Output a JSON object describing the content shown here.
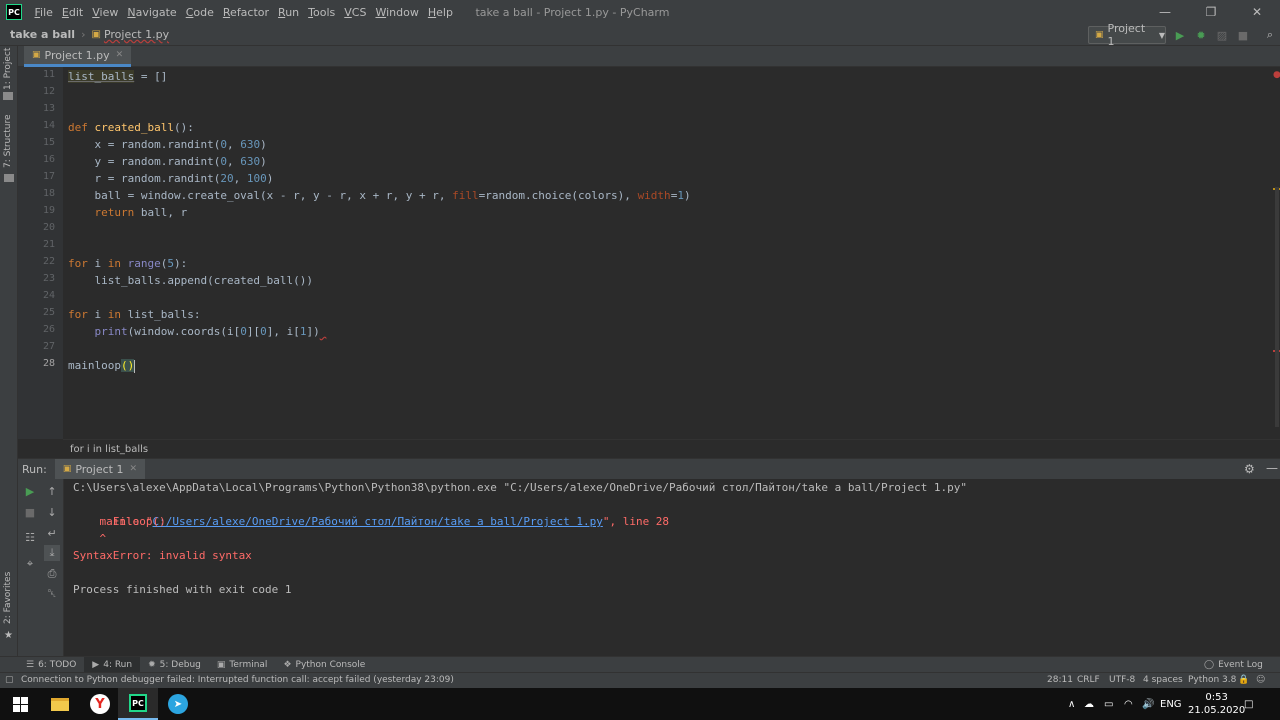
{
  "menubar": {
    "logo": "PC",
    "items": [
      "File",
      "Edit",
      "View",
      "Navigate",
      "Code",
      "Refactor",
      "Run",
      "Tools",
      "VCS",
      "Window",
      "Help"
    ],
    "window_title": "take a ball - Project 1.py - PyCharm"
  },
  "navbar": {
    "project": "take a ball",
    "file": "Project 1.py",
    "run_config": "Project 1"
  },
  "left_strip": {
    "project_tab": "1: Project",
    "structure_tab": "7: Structure",
    "favorites_tab": "2: Favorites"
  },
  "editor": {
    "tab_label": "Project 1.py",
    "line_numbers": [
      "11",
      "12",
      "13",
      "14",
      "15",
      "16",
      "17",
      "18",
      "19",
      "20",
      "21",
      "22",
      "23",
      "24",
      "25",
      "26",
      "27",
      "28"
    ],
    "breadcrumb": "for i in list_balls"
  },
  "run_panel": {
    "label": "Run:",
    "tab": "Project 1",
    "console": {
      "cmd": "C:\\Users\\alexe\\AppData\\Local\\Programs\\Python\\Python38\\python.exe \"C:/Users/alexe/OneDrive/Рабочий стол/Пайтон/take a ball/Project 1.py\"",
      "file_prefix": "  File \"",
      "file_link": "C:/Users/alexe/OneDrive/Рабочий стол/Пайтон/take a ball/Project 1.py",
      "file_suffix": "\", line 28",
      "code": "    mainloop()",
      "caret": "    ^",
      "error": "SyntaxError: invalid syntax",
      "finished": "Process finished with exit code 1"
    }
  },
  "toolwindows": {
    "todo": "6: TODO",
    "run": "4: Run",
    "debug": "5: Debug",
    "terminal": "Terminal",
    "python_console": "Python Console",
    "event_log": "Event Log"
  },
  "statusbar": {
    "message": "Connection to Python debugger failed: Interrupted function call: accept failed (yesterday 23:09)",
    "position": "28:11",
    "line_sep": "CRLF",
    "encoding": "UTF-8",
    "indent": "4 spaces",
    "interpreter": "Python 3.8"
  },
  "taskbar": {
    "lang": "ENG",
    "time": "0:53",
    "date": "21.05.2020"
  },
  "colors": {
    "accent": "#4a88c7",
    "run_green": "#499c54",
    "error_red": "#ff6b68"
  }
}
